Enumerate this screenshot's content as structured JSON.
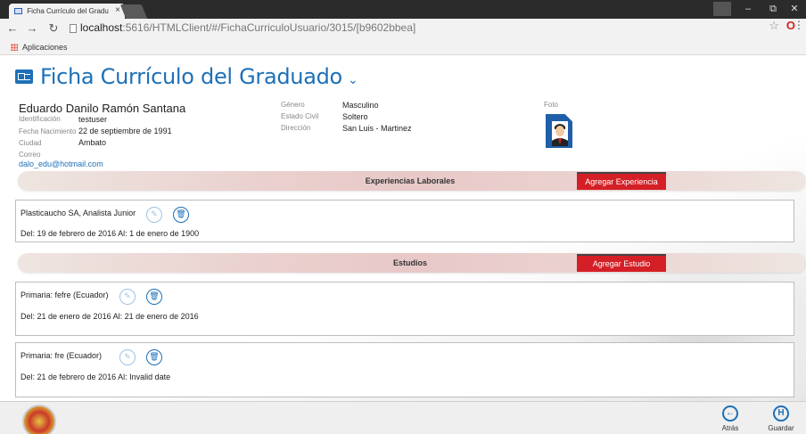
{
  "browser": {
    "tab_title": "Ficha Currículo del Gradu",
    "tab_close": "×",
    "url_host": "localhost",
    "url_path": ":5616/HTMLClient/#/FichaCurriculoUsuario/3015/[b9602bbea]",
    "bookmarks_label": "Aplicaciones",
    "window_controls": {
      "minimize": "–",
      "maximize": "⧉",
      "close": "✕"
    }
  },
  "header": {
    "title": "Ficha Currículo del Graduado",
    "title_icon": "id-card-icon",
    "chevron": "⌄"
  },
  "profile": {
    "name": "Eduardo Danilo Ramón Santana",
    "identificacion_label": "Identificación",
    "identificacion": "testuser",
    "nacimiento_label": "Fecha Nacimiento",
    "nacimiento": "22 de septiembre de 1991",
    "ciudad_label": "Ciudad",
    "ciudad": "Ambato",
    "correo_label": "Correo",
    "correo": "dalo_edu@hotmail.com",
    "genero_label": "Género",
    "genero": "Masculino",
    "estado_civil_label": "Estado Civil",
    "estado_civil": "Soltero",
    "direccion_label": "Dirección",
    "direccion": "San Luis - Martinez",
    "foto_label": "Foto"
  },
  "experiencias": {
    "title": "Experiencias Laborales",
    "add_button": "Agregar Experiencia",
    "items": [
      {
        "title": "Plasticaucho SA, Analista Junior",
        "dates": "Del: 19 de febrero de 2016 Al: 1 de enero de 1900"
      }
    ]
  },
  "estudios": {
    "title": "Estudios",
    "add_button": "Agregar Estudio",
    "items": [
      {
        "title": "Primaria: fefre  (Ecuador)",
        "dates": "Del: 21 de enero de 2016 Al: 21 de enero de 2016"
      },
      {
        "title": "Primaria: fre    (Ecuador)",
        "dates": "Del: 21 de febrero de 2016 Al: Invalid date"
      }
    ]
  },
  "footer": {
    "back_label": "Atrás",
    "save_label": "Guardar"
  },
  "colors": {
    "accent": "#1d70b8",
    "button_red": "#d41f26"
  }
}
